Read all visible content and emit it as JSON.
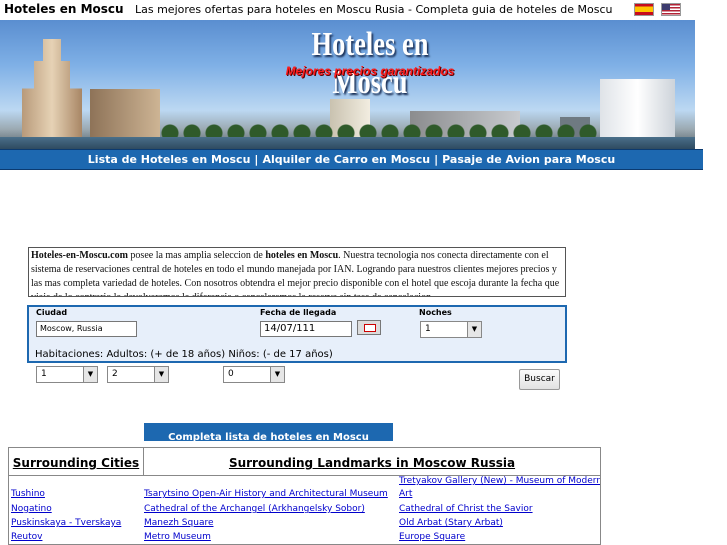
{
  "header": {
    "site_name": "Hoteles en Moscu",
    "tagline": "Las mejores ofertas para hoteles en Moscu Rusia  -  Completa guia de hoteles de Moscu",
    "flags": [
      "spanish-flag-icon",
      "us-flag-icon"
    ]
  },
  "banner": {
    "title": "Hoteles en Moscu",
    "subtitle": "Mejores precios garantizados"
  },
  "nav": {
    "items": [
      "Lista de Hoteles en Moscu",
      "Alquiler de Carro en Moscu",
      "Pasaje de Avion para Moscu"
    ],
    "separator": "|"
  },
  "description": {
    "brand": "Hoteles-en-Moscu.com",
    "text1": " posee la mas amplia seleccion de ",
    "bold": "hoteles en Moscu",
    "text2": ". Nuestra tecnologia nos conecta directamente con el sistema de reservaciones central de hoteles en todo el mundo manejada por IAN. Logrando para nuestros clientes mejores precios y las mas completa variedad de hoteles. Con nosotros obtendra el mejor precio disponible con el hotel que escoja durante la fecha que viaja de lo contrario le devolveremos la diferencia o cancelaremos la reserva sin tasa de cancelacion"
  },
  "search": {
    "city_label": "Ciudad",
    "city_value": "Moscow, Russia",
    "date_label": "Fecha de llegada",
    "date_value": "14/07/111",
    "nights_label": "Noches",
    "nights_value": "1",
    "rooms_label": "Habitaciones:",
    "adults_label": "Adultos: (+ de 18 años)",
    "children_label": "Niños: (- de 17 años)",
    "rooms_value": "1",
    "adults_value": "2",
    "children_value": "0",
    "submit_label": "Buscar"
  },
  "list_banner": "Completa lista de hoteles en Moscu",
  "surrounding": {
    "cities_header": "Surrounding Cities",
    "landmarks_header": "Surrounding Landmarks in Moscow Russia",
    "cities": [
      "Tushino",
      "Nogatino",
      "Puskinskaya - Tverskaya",
      "Reutov"
    ],
    "landmarks_col1": [
      "Tsarytsino Open-Air History and Architectural Museum",
      "Cathedral of the Archangel (Arkhangelsky Sobor)",
      "Manezh Square",
      "Metro Museum"
    ],
    "landmarks_col2": [
      "Tretyakov Gallery (New) - Museum of Modern",
      "Art",
      "Cathedral of Christ the Savior",
      "Old Arbat (Stary Arbat)",
      "Europe Square"
    ]
  },
  "colors": {
    "nav_blue": "#1d68b0",
    "search_bg": "#e7effa",
    "link": "#0000cc",
    "subtitle_red": "#ff1a1a"
  }
}
